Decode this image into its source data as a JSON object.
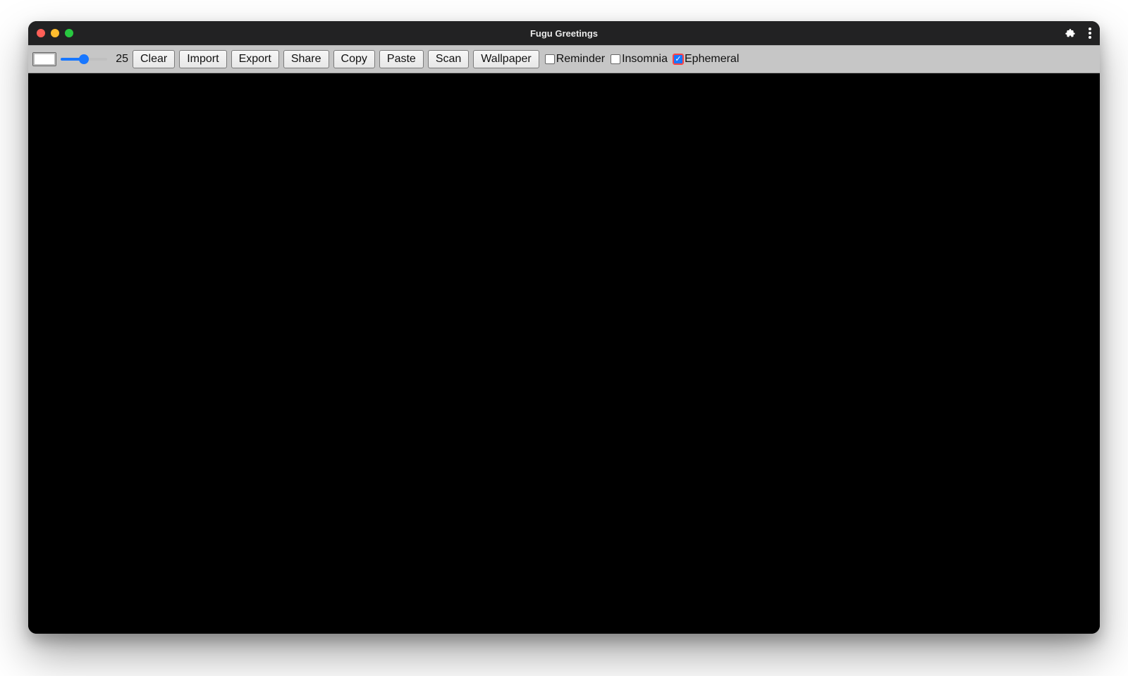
{
  "window": {
    "title": "Fugu Greetings"
  },
  "toolbar": {
    "slider_value": "25",
    "slider_percent": 50,
    "buttons": {
      "clear": "Clear",
      "import": "Import",
      "export": "Export",
      "share": "Share",
      "copy": "Copy",
      "paste": "Paste",
      "scan": "Scan",
      "wallpaper": "Wallpaper"
    },
    "checkboxes": {
      "reminder": {
        "label": "Reminder",
        "checked": false
      },
      "insomnia": {
        "label": "Insomnia",
        "checked": false
      },
      "ephemeral": {
        "label": "Ephemeral",
        "checked": true
      }
    }
  },
  "colors": {
    "accent": "#1877ff",
    "toolbar_bg": "#c6c6c6",
    "canvas_bg": "#000000"
  }
}
